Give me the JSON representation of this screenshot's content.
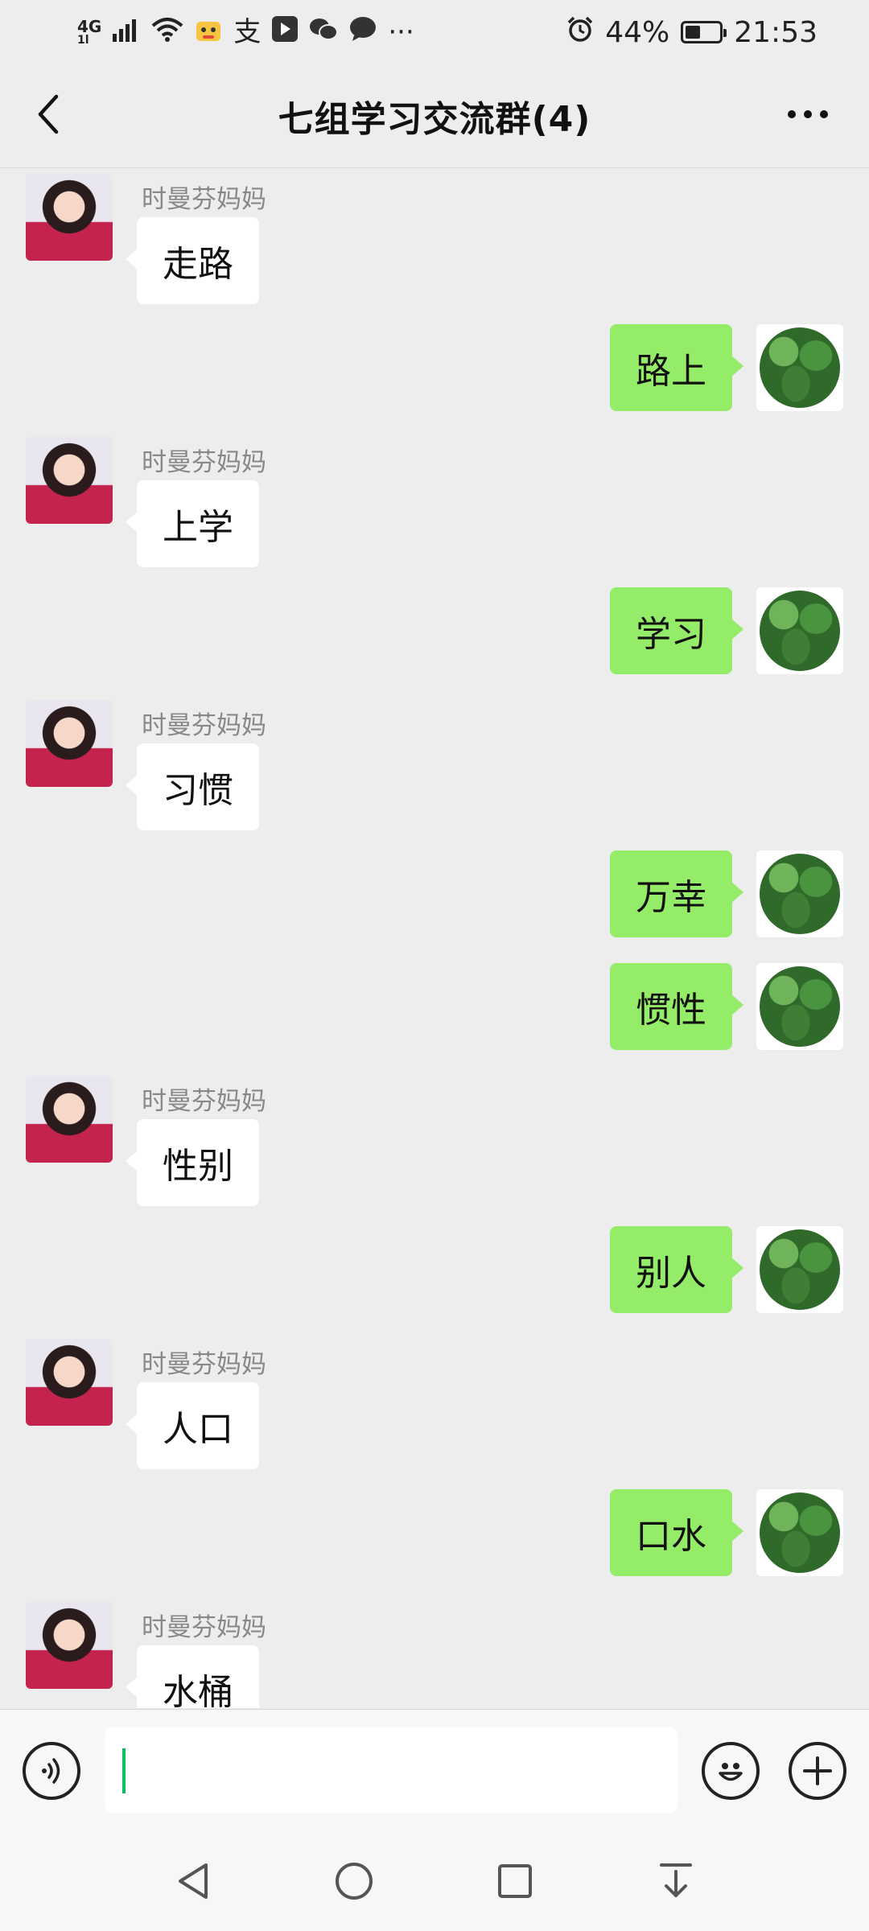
{
  "status_bar": {
    "network": "4G",
    "network_sub": "1l",
    "app_icons": [
      "wifi-icon",
      "paw-icon",
      "alipay-icon",
      "video-icon",
      "wechat-icon",
      "chat-icon"
    ],
    "more": "···",
    "alarm_icon": "alarm-icon",
    "battery": "44%",
    "battery_level": 0.44,
    "time": "21:53"
  },
  "header": {
    "title": "七组学习交流群(4)",
    "back_icon": "chevron-left-icon",
    "more_icon": "more-horizontal-icon"
  },
  "messages": [
    {
      "side": "other",
      "sender": "时曼芬妈妈",
      "text": "走路"
    },
    {
      "side": "self",
      "text": "路上"
    },
    {
      "side": "other",
      "sender": "时曼芬妈妈",
      "text": "上学"
    },
    {
      "side": "self",
      "text": "学习"
    },
    {
      "side": "other",
      "sender": "时曼芬妈妈",
      "text": "习惯"
    },
    {
      "side": "self",
      "text": "万幸"
    },
    {
      "side": "self",
      "text": "惯性"
    },
    {
      "side": "other",
      "sender": "时曼芬妈妈",
      "text": "性别"
    },
    {
      "side": "self",
      "text": "别人"
    },
    {
      "side": "other",
      "sender": "时曼芬妈妈",
      "text": "人口"
    },
    {
      "side": "self",
      "text": "口水"
    },
    {
      "side": "other",
      "sender": "时曼芬妈妈",
      "text": "水桶"
    }
  ],
  "input_bar": {
    "voice_icon": "voice-icon",
    "text_value": "",
    "emoji_icon": "emoji-icon",
    "plus_icon": "plus-icon"
  },
  "nav_bar": {
    "icons": [
      "back-triangle-icon",
      "home-circle-icon",
      "recents-square-icon",
      "notification-pull-icon"
    ]
  },
  "colors": {
    "self_bubble": "#95ec69",
    "other_bubble": "#ffffff",
    "background": "#ededed",
    "caret": "#07c160"
  }
}
